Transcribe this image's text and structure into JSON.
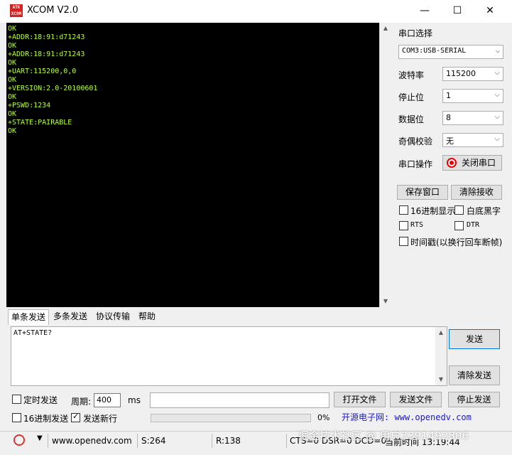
{
  "title_bar": {
    "logo": "ATK XCOM",
    "title": "XCOM V2.0",
    "minimize": "—",
    "maximize": "☐",
    "close": "✕"
  },
  "receive": {
    "text": "OK\n+ADDR:18:91:d71243\nOK\n+ADDR:18:91:d71243\nOK\n+UART:115200,0,0\nOK\n+VERSION:2.0-20100601\nOK\n+PSWD:1234\nOK\n+STATE:PAIRABLE\nOK"
  },
  "serial": {
    "port_label": "串口选择",
    "port_value": "COM3:USB-SERIAL",
    "baud_label": "波特率",
    "baud_value": "115200",
    "stop_label": "停止位",
    "stop_value": "1",
    "data_label": "数据位",
    "data_value": "8",
    "parity_label": "奇偶校验",
    "parity_value": "无",
    "op_label": "串口操作",
    "op_button": "关闭串口"
  },
  "receive_controls": {
    "save_window": "保存窗口",
    "clear_receive": "清除接收",
    "hex_display": "16进制显示",
    "white_black": "白底黑字",
    "rts": "RTS",
    "dtr": "DTR",
    "timestamp": "时间戳(以换行回车断帧)"
  },
  "tabs": [
    "单条发送",
    "多条发送",
    "协议传输",
    "帮助"
  ],
  "send": {
    "text": "AT+STATE?",
    "send_button": "发送",
    "clear_send": "清除发送",
    "timed_send": "定时发送",
    "period_label": "周期:",
    "period_value": "400",
    "period_unit": "ms",
    "open_file": "打开文件",
    "send_file": "发送文件",
    "stop_send": "停止发送",
    "hex_send": "16进制发送",
    "newline_send": "发送新行",
    "progress_text": "0%",
    "progress": 0,
    "site_banner": "开源电子网: www.openedv.com"
  },
  "status": {
    "url": "www.openedv.com",
    "s": "S:264",
    "r": "R:138",
    "signals": "CTS=0 DSR=0 DCD=0",
    "time": "当前时间 13:19:44"
  },
  "watermark": "掘金技术社区 @ 用户3391492806",
  "colors": {
    "recv_text": "#b7ff3a",
    "recv_bg": "#000000",
    "banner": "#1a1acc",
    "logo_red": "#d32222"
  }
}
